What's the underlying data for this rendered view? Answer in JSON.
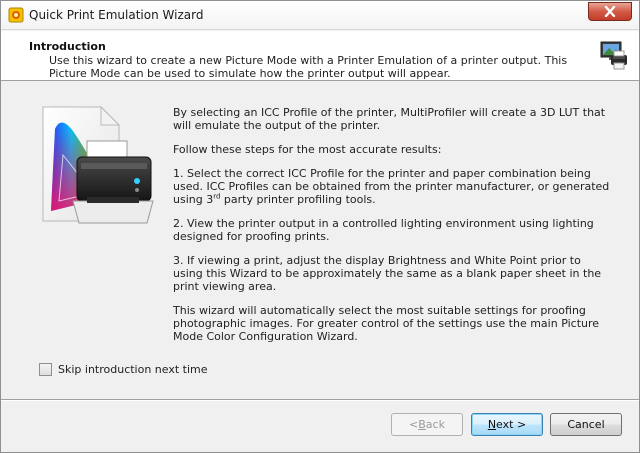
{
  "window": {
    "title": "Quick Print Emulation Wizard",
    "close_icon": "close-icon",
    "close_color": "#c43c28"
  },
  "header": {
    "title": "Introduction",
    "description": "Use this wizard to create a new Picture Mode with a Printer Emulation of a printer output. This Picture Mode can be used to simulate how the printer output will appear.",
    "icon": "monitor-printer-icon"
  },
  "illustration": {
    "icon": "color-gamut-printer-icon"
  },
  "content": {
    "para1": "By selecting an ICC Profile of the printer, MultiProfiler will create a 3D LUT that will emulate the output of the printer.",
    "para2": "Follow these steps for the most accurate results:",
    "step1_before": "1. Select the correct ICC Profile for the printer and paper combination being used. ICC Profiles can be obtained from the printer manufacturer, or generated using 3",
    "step1_sup": "rd",
    "step1_after": " party printer profiling tools.",
    "step2": "2. View the printer output in a controlled lighting environment using lighting designed for proofing prints.",
    "step3": "3. If viewing a print, adjust the display Brightness and White Point prior to using this Wizard to be approximately the same as a blank paper sheet in the print viewing area.",
    "para_final": "This wizard will automatically select the most suitable settings for proofing photographic images. For greater control of the settings use the main Picture Mode Color Configuration Wizard."
  },
  "skip": {
    "label": "Skip introduction next time",
    "checked": false
  },
  "buttons": {
    "back_prefix": "< ",
    "back_accel": "B",
    "back_rest": "ack",
    "next_accel": "N",
    "next_rest": "ext >",
    "cancel": "Cancel"
  }
}
